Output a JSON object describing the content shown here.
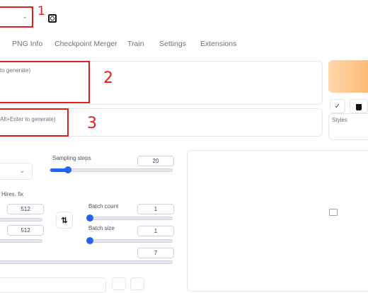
{
  "annotations": {
    "one": "1",
    "two": "2",
    "three": "3"
  },
  "tabs": [
    "PNG Info",
    "Checkpoint Merger",
    "Train",
    "Settings",
    "Extensions"
  ],
  "prompt": {
    "placeholder": "to generate)"
  },
  "negative_prompt": {
    "placeholder": "Alt+Enter to generate)"
  },
  "styles": {
    "label": "Styles"
  },
  "sampling_steps": {
    "label": "Sampling steps",
    "value": "20",
    "fraction": 0.14
  },
  "hires_fix": {
    "label": "Hires. fix"
  },
  "width": {
    "value": "512"
  },
  "height": {
    "value": "512"
  },
  "swap": {
    "icon": "swap-arrows-icon",
    "glyph": "⇅"
  },
  "batch_count": {
    "label": "Batch count",
    "value": "1"
  },
  "batch_size": {
    "label": "Batch size",
    "value": "1"
  },
  "cfg": {
    "value": "7"
  },
  "gallery": {
    "icon": "image-icon"
  },
  "colors": {
    "accent": "#2563eb",
    "annotation": "#e11d1d",
    "generate": "#fdba74"
  },
  "icons": {
    "refresh": "refresh-icon",
    "check": "check-icon",
    "trash": "trash-icon",
    "dropdown": "chevron-down-icon"
  }
}
